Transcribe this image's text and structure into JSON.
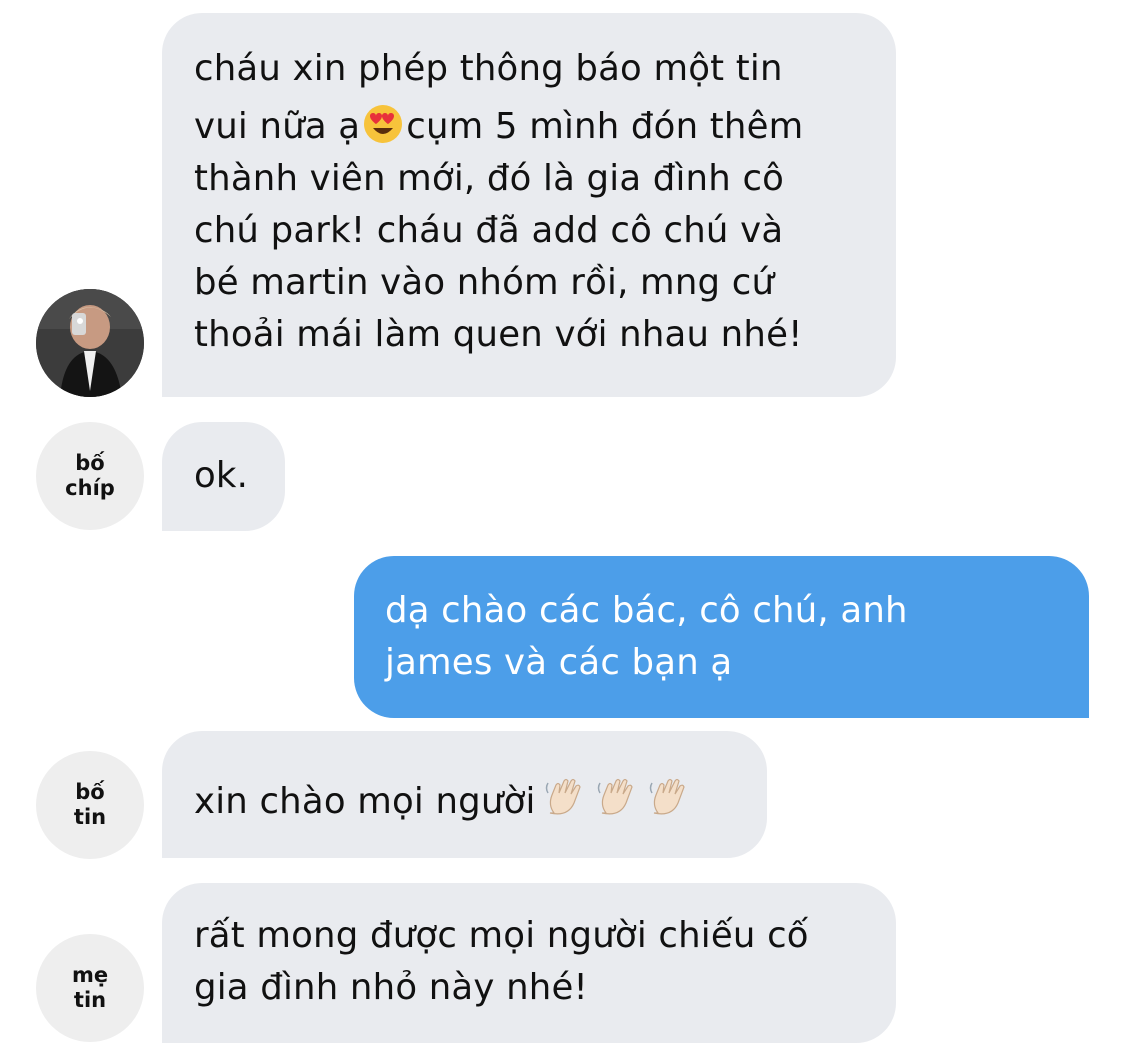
{
  "messages": [
    {
      "direction": "in",
      "sender_label": [],
      "lines": [
        "cháu xin phép thông báo một tin",
        "vui nữa ạ",
        "cụm 5 mình đón thêm",
        "thành viên mới, đó là gia đình cô",
        "chú park! cháu đã add cô chú và",
        "bé martin vào nhóm rồi, mng cứ",
        "thoải mái làm quen với nhau nhé!"
      ],
      "emoji": "heart-eyes-emoji"
    },
    {
      "direction": "in",
      "sender_label": [
        "bố",
        "chíp"
      ],
      "lines": [
        "ok."
      ]
    },
    {
      "direction": "out",
      "lines": [
        "dạ chào các bác, cô chú, anh",
        "james và các bạn ạ"
      ]
    },
    {
      "direction": "in",
      "sender_label": [
        "bố",
        "tin"
      ],
      "lines": [
        "xin chào mọi người"
      ],
      "emoji": "waving-hand-emoji"
    },
    {
      "direction": "in",
      "sender_label": [
        "mẹ",
        "tin"
      ],
      "lines": [
        "rất mong được mọi người chiếu cố",
        "gia đình nhỏ này nhé!"
      ]
    }
  ],
  "colors": {
    "incoming_bubble": "#e9ebef",
    "outgoing_bubble": "#4c9ee9",
    "avatar_background": "#eeeeee"
  }
}
